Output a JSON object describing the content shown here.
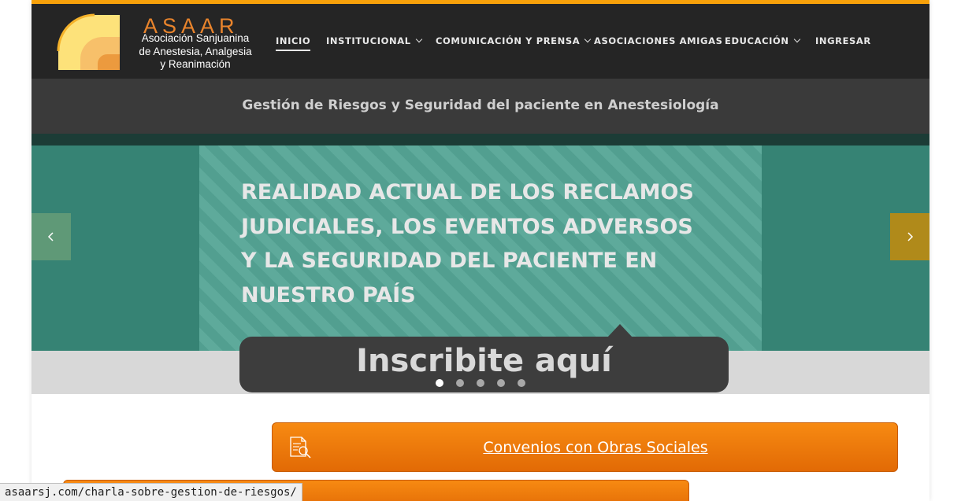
{
  "brand": {
    "title": "ASAAR",
    "subtitle_lines": [
      "Asociación Sanjuanina",
      "de Anestesia, Analgesia",
      "y Reanimación"
    ],
    "accent_color": "#f7a10a"
  },
  "nav": {
    "items": [
      {
        "label": "INICIO",
        "active": true,
        "dropdown": false
      },
      {
        "label": "INSTITUCIONAL",
        "active": false,
        "dropdown": true
      },
      {
        "label": "COMUNICACIÓN Y PRENSA",
        "active": false,
        "dropdown": true
      },
      {
        "label": "ASOCIACIONES AMIGAS",
        "active": false,
        "dropdown": false
      },
      {
        "label": "EDUCACIÓN",
        "active": false,
        "dropdown": true
      },
      {
        "label": "INGRESAR",
        "active": false,
        "dropdown": false
      }
    ]
  },
  "slider": {
    "caption": "Gestión de Riesgos y Seguridad del paciente en Anestesiología",
    "headline_lines": [
      "REALIDAD ACTUAL DE LOS RECLAMOS",
      "JUDICIALES, LOS EVENTOS ADVERSOS",
      "Y LA SEGURIDAD DEL PACIENTE EN",
      "NUESTRO PAÍS"
    ],
    "cta_label": "Inscribite aquí",
    "prev_icon": "chevron-left-icon",
    "next_icon": "chevron-right-icon",
    "slide_count": 5,
    "active_slide": 1
  },
  "main": {
    "convenios_label": "Convenios con Obras Sociales",
    "convenios_icon": "document-search-icon"
  },
  "status_bar": {
    "url": "asaarsj.com/charla-sobre-gestion-de-riesgos/"
  }
}
